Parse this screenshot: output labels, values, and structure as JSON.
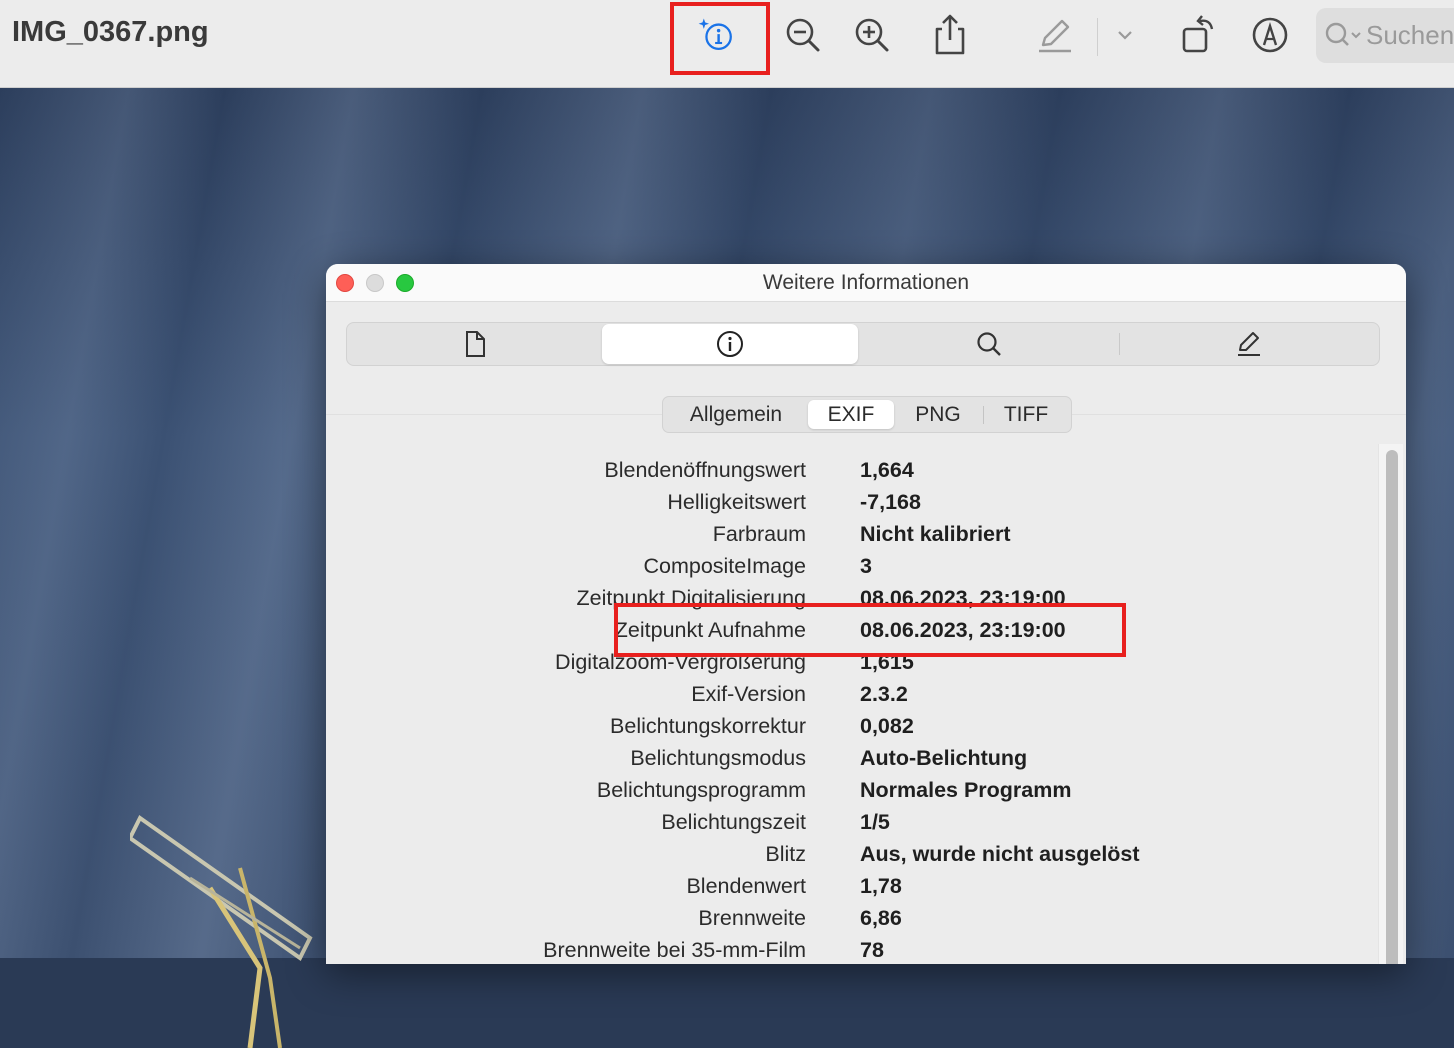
{
  "toolbar": {
    "doc_title": "IMG_0367.png",
    "icons": [
      "info-sparkle-icon",
      "zoom-out-icon",
      "zoom-in-icon",
      "share-icon",
      "markup-pen-icon",
      "chevron-down-icon",
      "rotate-icon",
      "markup-circle-icon"
    ],
    "search_placeholder": "Suchen"
  },
  "window": {
    "title": "Weitere Informationen",
    "main_tabs": [
      "document-icon",
      "info-icon",
      "search-icon",
      "edit-icon"
    ],
    "sub_tabs": [
      "Allgemein",
      "EXIF",
      "PNG",
      "TIFF"
    ],
    "active_sub_tab": "EXIF"
  },
  "exif": [
    {
      "key": "Blendenöffnungswert",
      "value": "1,664"
    },
    {
      "key": "Helligkeitswert",
      "value": "-7,168"
    },
    {
      "key": "Farbraum",
      "value": "Nicht kalibriert"
    },
    {
      "key": "CompositeImage",
      "value": "3"
    },
    {
      "key": "Zeitpunkt Digitalisierung",
      "value": "08.06.2023, 23:19:00"
    },
    {
      "key": "Zeitpunkt Aufnahme",
      "value": "08.06.2023, 23:19:00"
    },
    {
      "key": "Digitalzoom-Vergroßerung",
      "value": "1,615"
    },
    {
      "key": "Exif-Version",
      "value": "2.3.2"
    },
    {
      "key": "Belichtungskorrektur",
      "value": "0,082"
    },
    {
      "key": "Belichtungsmodus",
      "value": "Auto-Belichtung"
    },
    {
      "key": "Belichtungsprogramm",
      "value": "Normales Programm"
    },
    {
      "key": "Belichtungszeit",
      "value": "1/5"
    },
    {
      "key": "Blitz",
      "value": "Aus, wurde nicht ausgelöst"
    },
    {
      "key": "Blendenwert",
      "value": "1,78"
    },
    {
      "key": "Brennweite",
      "value": "6,86"
    },
    {
      "key": "Brennweite bei 35-mm-Film",
      "value": "78"
    }
  ],
  "colors": {
    "highlight": "#e8201e",
    "accent": "#1a73e8"
  }
}
